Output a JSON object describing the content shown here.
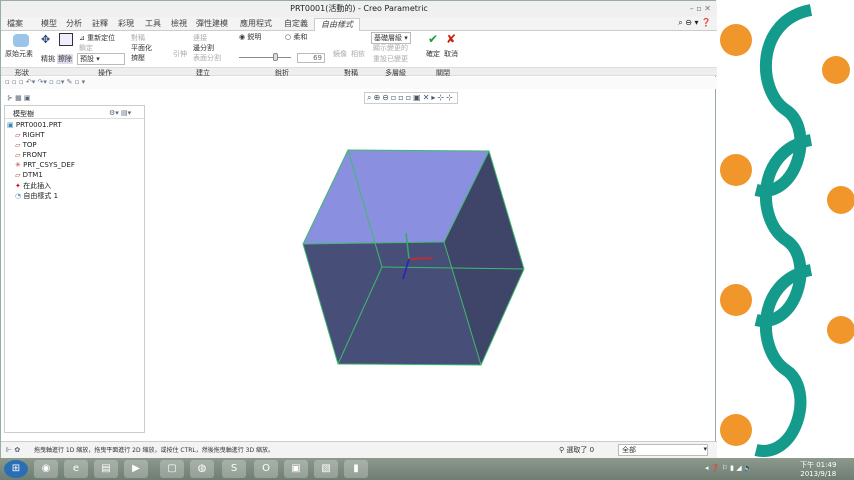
{
  "window": {
    "title": "PRT0001(活動的) - Creo Parametric"
  },
  "menu": {
    "tabs": [
      "檔案",
      "模型",
      "分析",
      "註釋",
      "彩現",
      "工具",
      "檢視",
      "彈性建模",
      "應用程式",
      "自定義",
      "自由樣式"
    ],
    "active": "自由樣式"
  },
  "ribbon": {
    "primitive": "原始元素",
    "refine": "精挑",
    "erase": "擦除",
    "reposition": "重新定位",
    "lock": "鎖定",
    "default_sel": "預設",
    "symmetry": "對稱",
    "planarize": "平面化",
    "extrude": "擠壓",
    "junction": "引伸",
    "connect": "連接",
    "edge_split": "邊分割",
    "face_split": "表面分割",
    "sharp": "鋭明",
    "soft": "柔和",
    "crease_value": "69",
    "mirror": "鏡像",
    "align": "相依",
    "base_level": "基礎層級",
    "show_changed": "顯示變更的",
    "reset_changed": "重設已變更",
    "ok": "確定",
    "cancel": "取消"
  },
  "groups": [
    "形狀",
    "操作",
    "建立",
    "銳折",
    "對稱",
    "多層級",
    "關閉"
  ],
  "tree": {
    "title": "模型樹",
    "items": [
      "PRT0001.PRT",
      "RIGHT",
      "TOP",
      "FRONT",
      "PRT_CSYS_DEF",
      "DTM1",
      "在此插入",
      "自由樣式 1"
    ]
  },
  "status": {
    "message": "拖曳軸進行 1D 縮放，拖曳平面進行 2D 縮放，或按住 CTRL，然後拖曳軸進行 3D 縮放。",
    "selected": "選取了 0",
    "filter": "全部"
  },
  "clock": {
    "time": "下午 01:49",
    "date": "2013/9/18"
  },
  "colors": {
    "top_face": "#8a8fe0",
    "side_face": "#434a72",
    "edge": "#3dbb6e"
  }
}
